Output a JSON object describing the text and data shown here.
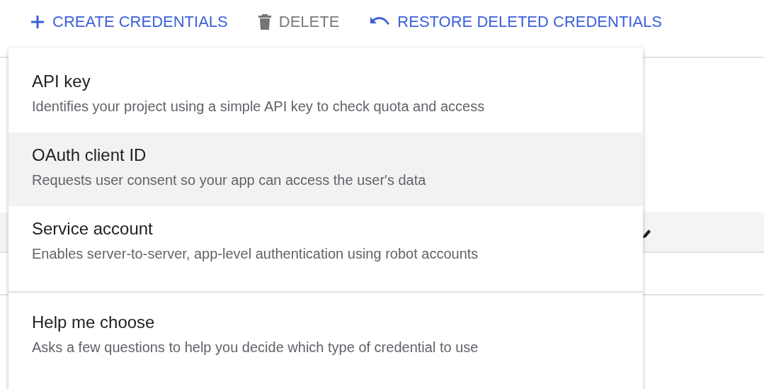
{
  "toolbar": [
    {
      "kind": "create",
      "label": "CREATE CREDENTIALS",
      "disabled": false
    },
    {
      "kind": "delete",
      "label": "DELETE",
      "disabled": true
    },
    {
      "kind": "restore",
      "label": "RESTORE DELETED CREDENTIALS",
      "disabled": false
    }
  ],
  "menu": {
    "items": [
      {
        "title": "API key",
        "description": "Identifies your project using a simple API key to check quota and access",
        "highlighted": false
      },
      {
        "title": "OAuth client ID",
        "description": "Requests user consent so your app can access the user's data",
        "highlighted": true
      },
      {
        "title": "Service account",
        "description": "Enables server-to-server, app-level authentication using robot accounts",
        "highlighted": false
      }
    ],
    "footer_items": [
      {
        "title": "Help me choose",
        "description": "Asks a few questions to help you decide which type of credential to use",
        "highlighted": false
      }
    ]
  }
}
